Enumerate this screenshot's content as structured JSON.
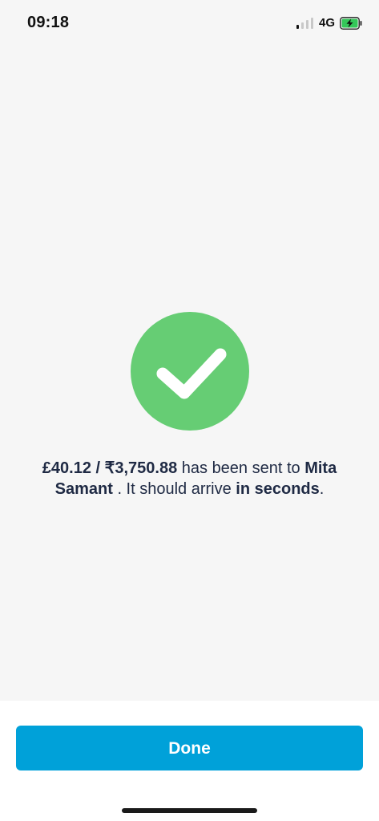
{
  "status_bar": {
    "time": "09:18",
    "network": "4G",
    "battery_state": "charging",
    "signal_bars_active": 1,
    "signal_bars_total": 4
  },
  "confirmation": {
    "icon": "checkmark-icon",
    "amount_text": "£40.12 / ₹3,750.88",
    "sent_to_text": " has been sent to ",
    "recipient_name": "Mita Samant",
    "arrival_prefix": " . It should arrive ",
    "arrival_time_text": "in seconds",
    "arrival_suffix": "."
  },
  "footer": {
    "done_label": "Done"
  },
  "colors": {
    "success_green": "#66cd74",
    "primary_button": "#00a1d9",
    "text_dark": "#1f2a44",
    "battery_green": "#34c759"
  }
}
